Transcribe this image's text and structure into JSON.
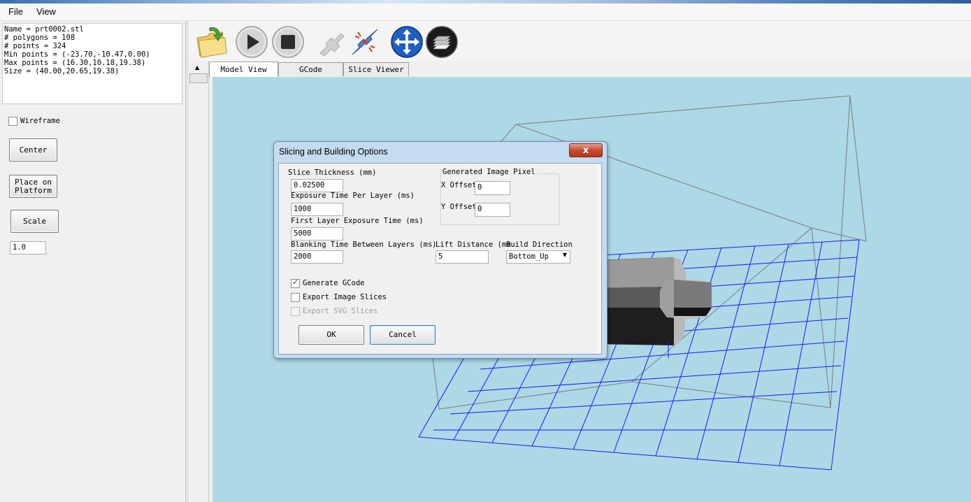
{
  "menu": {
    "file": "File",
    "view": "View"
  },
  "model_info": [
    "Name = prt0002.stl",
    "# polygons = 108",
    "# points = 324",
    "Min points = (-23.70,-10.47,0.00)",
    "Max points = (16.30,10.18,19.38)",
    "Size = (40.00,20.65,19.38)"
  ],
  "left_panel": {
    "wireframe_label": "Wireframe",
    "center_label": "Center",
    "place_on_platform_line1": "Place on",
    "place_on_platform_line2": "Platform",
    "scale_label": "Scale",
    "scale_value": "1.0"
  },
  "toolbar": {
    "icons": [
      "open-folder-icon",
      "play-icon",
      "stop-icon",
      "slice-disabled-icon",
      "connect-icon",
      "move-arrows-icon",
      "slice-stack-icon"
    ]
  },
  "tabs": [
    "Model View",
    "GCode",
    "Slice Viewer"
  ],
  "dialog": {
    "title": "Slicing and Building Options",
    "close": "x",
    "slice_thickness_label": "Slice Thickness (mm)",
    "slice_thickness_value": "0.02500",
    "exposure_label": "Exposure Time Per Layer (ms)",
    "exposure_value": "1000",
    "first_layer_label": "First Layer Exposure Time (ms)",
    "first_layer_value": "5000",
    "blanking_label": "Blanking Time Between Layers (ms)",
    "blanking_value": "2000",
    "lift_distance_label": "Lift Distance (mm",
    "lift_distance_value": "5",
    "build_direction_label": "Build Direction",
    "build_direction_value": "Bottom_Up",
    "pixel_offsets_label": "Generated Image Pixel Offsets",
    "x_offset_label": "X Offset",
    "x_offset_value": "0",
    "y_offset_label": "Y Offset",
    "y_offset_value": "0",
    "generate_gcode_label": "Generate GCode",
    "generate_gcode_checked": true,
    "export_image_label": "Export Image Slices",
    "export_image_checked": false,
    "export_svg_label": "Export SVG Slices",
    "export_svg_enabled": false,
    "ok_label": "OK",
    "cancel_label": "Cancel"
  },
  "colors": {
    "viewport_bg": "#add8e6",
    "grid_blue": "#1a1aff",
    "box_gray": "#7c7c7c",
    "dialog_frame": "#c4dbf0"
  }
}
